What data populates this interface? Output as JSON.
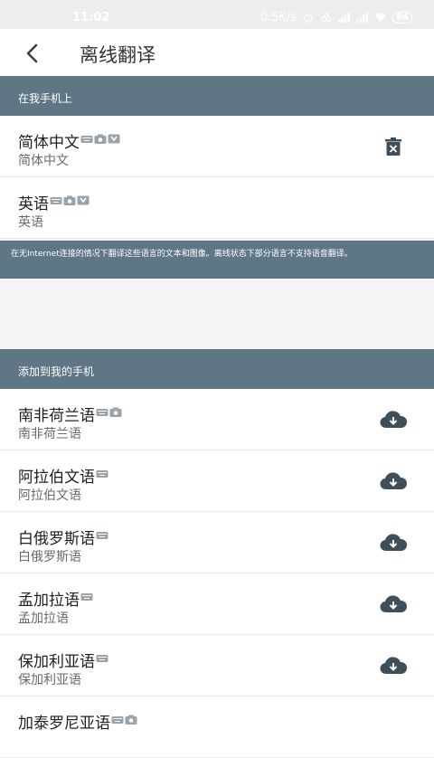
{
  "status_bar": {
    "time": "11:02",
    "net_speed": "0.5K/s",
    "battery": "64",
    "icons": [
      "alarm-icon",
      "data-saver-icon",
      "signal-icon",
      "signal-icon",
      "wifi-icon",
      "battery-icon"
    ]
  },
  "app_bar": {
    "title": "离线翻译",
    "back_icon": "arrow-back-icon"
  },
  "on_device": {
    "header": "在我手机上",
    "items": [
      {
        "title": "简体中文",
        "subtitle": "简体中文",
        "features": [
          "keyboard",
          "camera",
          "mic"
        ],
        "action": "delete"
      },
      {
        "title": "英语",
        "subtitle": "英语",
        "features": [
          "keyboard",
          "camera",
          "mic"
        ],
        "action": "none"
      }
    ]
  },
  "notice": {
    "text": "在无Internet连接的情况下翻译这些语言的文本和图像。离线状态下部分语言不支持语音翻译。"
  },
  "available": {
    "header": "添加到我的手机",
    "items": [
      {
        "title": "南非荷兰语",
        "subtitle": "南非荷兰语",
        "features": [
          "keyboard",
          "camera"
        ],
        "action": "download"
      },
      {
        "title": "阿拉伯文语",
        "subtitle": "阿拉伯文语",
        "features": [
          "keyboard"
        ],
        "action": "download"
      },
      {
        "title": "白俄罗斯语",
        "subtitle": "白俄罗斯语",
        "features": [
          "keyboard"
        ],
        "action": "download"
      },
      {
        "title": "孟加拉语",
        "subtitle": "孟加拉语",
        "features": [
          "keyboard"
        ],
        "action": "download"
      },
      {
        "title": "保加利亚语",
        "subtitle": "保加利亚语",
        "features": [
          "keyboard"
        ],
        "action": "download"
      },
      {
        "title": "加泰罗尼亚语",
        "subtitle": "",
        "features": [
          "keyboard",
          "camera"
        ],
        "action": "none"
      }
    ]
  },
  "colors": {
    "header_bg": "#5f7785",
    "icon": "#3e4f59",
    "feature_icon": "#9aa3aa"
  }
}
